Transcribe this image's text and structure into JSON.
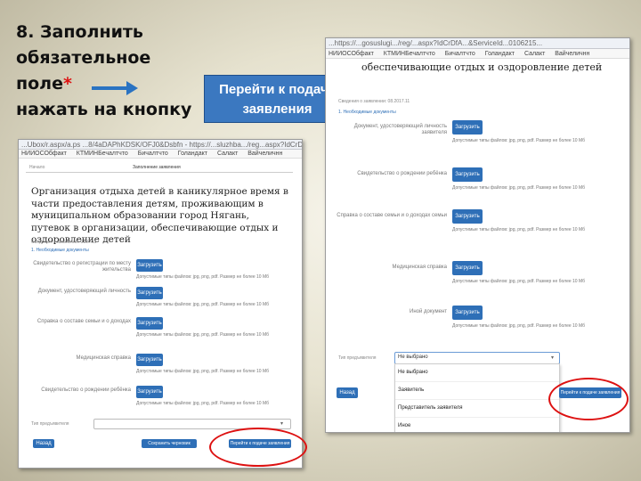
{
  "slide": {
    "instruction_lines": [
      "8. Заполнить",
      "обязательное",
      "поле",
      "нажать на кнопку"
    ],
    "required_star": "*",
    "callout_button_label": "Перейти к подаче заявления"
  },
  "colors": {
    "accent": "#2e6fb7",
    "highlight_ring": "#dd1111",
    "arrow": "#2a73c2"
  },
  "left_screen": {
    "url_text": "...Ubox/r.aspx/a.ps ...8/4aDAPhKDSK/OFJ0&Dsbfn - https://...sluzhba.../reg...aspx?IdCrDfA...",
    "bookmarks": [
      "НИИОСОбфакт",
      "КТМИНБечалтчто",
      "Бичалтчто",
      "Голандакт",
      "Салакт",
      "Вайчеличнн"
    ],
    "tab_labels": [
      "Начало",
      "Заполнение заявления"
    ],
    "main_title": "Организация отдыха детей в каникулярное время в части предоставления детям, проживающим в муниципальном образовании город Нягань, путевок в организации, обеспечивающие отдых и оздоровление детей",
    "meta_line": "Сведения о заявлении: 0107.11",
    "section_label": "1. Необходимые документы",
    "document_rows": [
      {
        "label": "Свидетельство о регистрации по месту жительства",
        "button": "Загрузить",
        "hint": "Допустимые типы файлов: jpg, png, pdf. Размер не более 10 Мб"
      },
      {
        "label": "Документ, удостоверяющий личность",
        "button": "Загрузить",
        "hint": "Допустимые типы файлов: jpg, png, pdf. Размер не более 10 Мб"
      },
      {
        "label": "Справка о составе семьи и о доходах",
        "button": "Загрузить",
        "hint": "Допустимые типы файлов: jpg, png, pdf. Размер не более 10 Мб"
      },
      {
        "label": "Медицинская справка",
        "button": "Загрузить",
        "hint": "Допустимые типы файлов: jpg, png, pdf. Размер не более 10 Мб"
      },
      {
        "label": "Свидетельство о рождении ребёнка",
        "button": "Загрузить",
        "hint": "Допустимые типы файлов: jpg, png, pdf. Размер не более 10 Мб"
      }
    ],
    "select_label": "Тип предъявителя",
    "back_button": "Назад",
    "middle_button": "Сохранить черновик",
    "submit_button": "Перейти к подаче заявления"
  },
  "right_screen": {
    "url_text": "...https://...gosuslugi.../reg/...aspx?IdCrDfA...&ServiceId...0106215...",
    "bookmarks": [
      "НИИОСОбфакт",
      "КТМИНБечалтчто",
      "Бичалтчто",
      "Голандакт",
      "Салакт",
      "Вайчеличнн"
    ],
    "title": "обеспечивающие отдых и оздоровление детей",
    "meta_line": "Сведения о заявлении: 08.2017.11",
    "section_label": "1. Необходимые документы",
    "document_rows": [
      {
        "label": "Документ, удостоверяющий личность заявителя",
        "button": "Загрузить",
        "hint": "Допустимые типы файлов: jpg, png, pdf. Размер не более 10 Мб"
      },
      {
        "label": "Свидетельство о рождении ребёнка",
        "button": "Загрузить",
        "hint": "Допустимые типы файлов: jpg, png, pdf. Размер не более 10 Мб"
      },
      {
        "label": "Справка о составе семьи и о доходах семьи",
        "button": "Загрузить",
        "hint": "Допустимые типы файлов: jpg, png, pdf. Размер не более 10 Мб"
      },
      {
        "label": "Медицинская справка",
        "button": "Загрузить",
        "hint": "Допустимые типы файлов: jpg, png, pdf. Размер не более 10 Мб"
      },
      {
        "label": "Иной документ",
        "button": "Загрузить",
        "hint": "Допустимые типы файлов: jpg, png, pdf. Размер не более 10 Мб"
      }
    ],
    "select_label": "Тип предъявителя",
    "select_value": "Не выбрано",
    "dropdown_options": [
      "Не выбрано",
      "Заявитель",
      "Представитель заявителя",
      "Иное"
    ],
    "back_button": "Назад",
    "submit_button": "Перейти к подаче заявления"
  }
}
